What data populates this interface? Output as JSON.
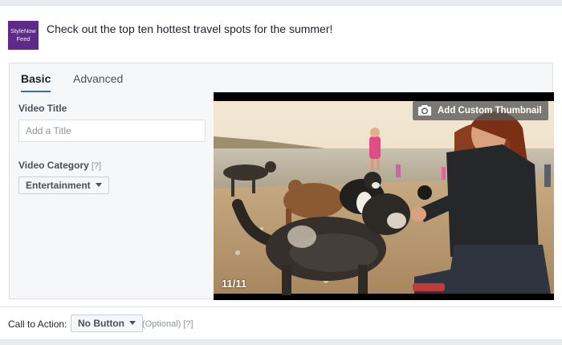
{
  "post": {
    "avatar_line1": "StyleNow",
    "avatar_line2": "Feed",
    "status_text": "Check out the top ten hottest travel spots for the summer!"
  },
  "tabs": [
    {
      "label": "Basic",
      "active": true
    },
    {
      "label": "Advanced",
      "active": false
    }
  ],
  "form": {
    "video_title_label": "Video Title",
    "video_title_placeholder": "Add a Title",
    "video_title_value": "",
    "video_category_label": "Video Category",
    "help_mark": "[?]",
    "category_selected": "Entertainment"
  },
  "video": {
    "thumbnail_button_label": "Add Custom Thumbnail",
    "frame_counter": "11/11",
    "camera_icon": "camera-icon"
  },
  "cta": {
    "label": "Call to Action:",
    "selected": "No Button",
    "optional_text": "(Optional)",
    "help_mark": "[?]"
  },
  "colors": {
    "avatar_bg": "#5d2a8a",
    "tab_active_underline": "#4267b2",
    "panel_bg": "#f6f7f9"
  }
}
